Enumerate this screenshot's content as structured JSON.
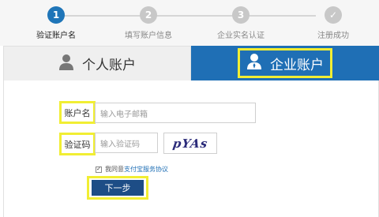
{
  "steps": [
    {
      "num": "1",
      "label": "验证账户名"
    },
    {
      "num": "2",
      "label": "填写账户信息"
    },
    {
      "num": "3",
      "label": "企业实名认证"
    },
    {
      "num": "✓",
      "label": "注册成功"
    }
  ],
  "tabs": {
    "personal": {
      "label": "个人账户",
      "icon": "person-icon"
    },
    "business": {
      "label": "企业账户",
      "icon": "business-person-icon"
    }
  },
  "form": {
    "account_label": "账户名",
    "account_placeholder": "输入电子邮箱",
    "captcha_label": "验证码",
    "captcha_placeholder": "输入验证码",
    "captcha_image_text": "pYAs",
    "agree_prefix": "我同意",
    "agree_link": "支付宝服务协议",
    "agree_checked": true,
    "submit_label": "下一步"
  },
  "colors": {
    "accent": "#1f6fb5",
    "highlight": "#f1ee33",
    "button": "#1d4d86"
  }
}
